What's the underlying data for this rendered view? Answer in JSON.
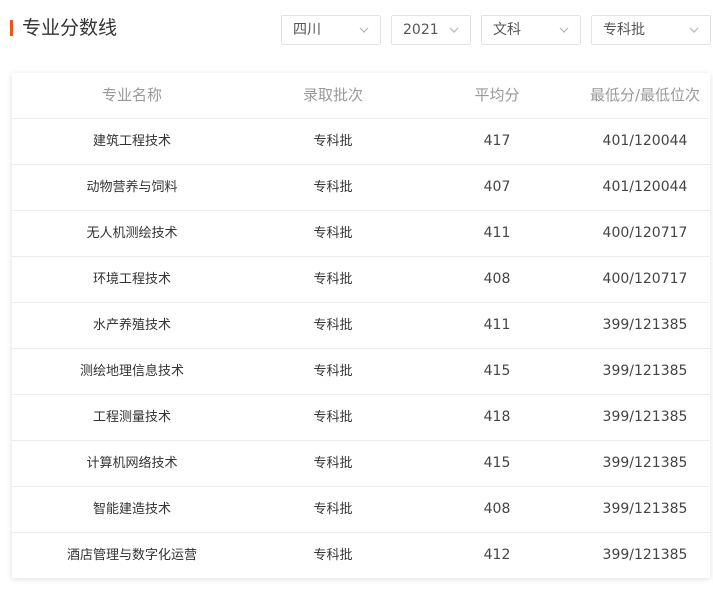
{
  "header": {
    "title": "专业分数线"
  },
  "filters": {
    "province": "四川",
    "year": "2021",
    "subject": "文科",
    "batch": "专科批"
  },
  "table": {
    "columns": [
      "专业名称",
      "录取批次",
      "平均分",
      "最低分/最低位次"
    ],
    "rows": [
      {
        "major": "建筑工程技术",
        "batch": "专科批",
        "avg": "417",
        "min": "401/120044"
      },
      {
        "major": "动物营养与饲料",
        "batch": "专科批",
        "avg": "407",
        "min": "401/120044"
      },
      {
        "major": "无人机测绘技术",
        "batch": "专科批",
        "avg": "411",
        "min": "400/120717"
      },
      {
        "major": "环境工程技术",
        "batch": "专科批",
        "avg": "408",
        "min": "400/120717"
      },
      {
        "major": "水产养殖技术",
        "batch": "专科批",
        "avg": "411",
        "min": "399/121385"
      },
      {
        "major": "测绘地理信息技术",
        "batch": "专科批",
        "avg": "415",
        "min": "399/121385"
      },
      {
        "major": "工程测量技术",
        "batch": "专科批",
        "avg": "418",
        "min": "399/121385"
      },
      {
        "major": "计算机网络技术",
        "batch": "专科批",
        "avg": "415",
        "min": "399/121385"
      },
      {
        "major": "智能建造技术",
        "batch": "专科批",
        "avg": "408",
        "min": "399/121385"
      },
      {
        "major": "酒店管理与数字化运营",
        "batch": "专科批",
        "avg": "412",
        "min": "399/121385"
      }
    ]
  },
  "colors": {
    "accent": "#e85a1c",
    "header_text": "#999999",
    "cell_text": "#333333",
    "border": "#ececec"
  },
  "icons": {
    "dropdown": "chevron-down-icon"
  }
}
